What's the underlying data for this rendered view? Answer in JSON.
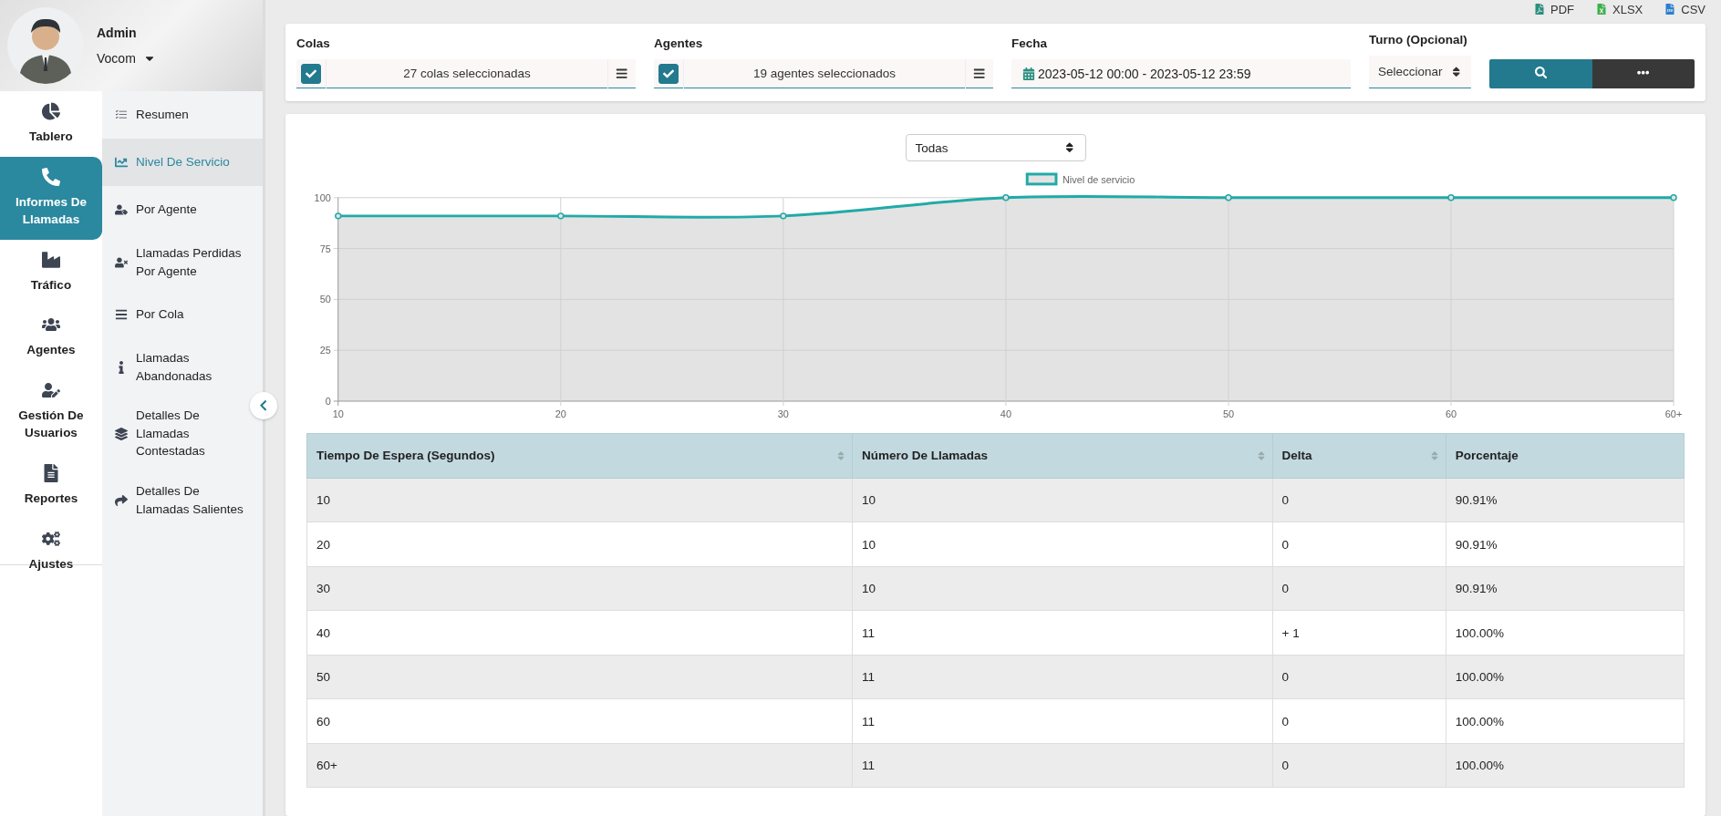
{
  "user": {
    "name": "Admin",
    "company": "Vocom"
  },
  "nav": [
    {
      "label": "Tablero",
      "selected": false
    },
    {
      "label": "Informes De Llamadas",
      "selected": true
    },
    {
      "label": "Tráfico",
      "selected": false
    },
    {
      "label": "Agentes",
      "selected": false
    },
    {
      "label": "Gestión De Usuarios",
      "selected": false
    },
    {
      "label": "Reportes",
      "selected": false
    },
    {
      "label": "Ajustes",
      "selected": false
    }
  ],
  "submenu": [
    {
      "label": "Resumen",
      "selected": false
    },
    {
      "label": "Nivel De Servicio",
      "selected": true
    },
    {
      "label": "Por Agente",
      "selected": false
    },
    {
      "label": "Llamadas Perdidas Por Agente",
      "selected": false
    },
    {
      "label": "Por Cola",
      "selected": false
    },
    {
      "label": "Llamadas Abandonadas",
      "selected": false
    },
    {
      "label": "Detalles De Llamadas Contestadas",
      "selected": false
    },
    {
      "label": "Detalles De Llamadas Salientes",
      "selected": false
    }
  ],
  "exports": [
    "PDF",
    "XLSX",
    "CSV"
  ],
  "filters": {
    "colas": {
      "label": "Colas",
      "checked": true,
      "value": "27 colas seleccionadas"
    },
    "agentes": {
      "label": "Agentes",
      "checked": true,
      "value": "19 agentes seleccionados"
    },
    "fecha": {
      "label": "Fecha",
      "value": "2023-05-12 00:00 - 2023-05-12 23:59"
    },
    "turno": {
      "label": "Turno (Opcional)",
      "value": "Seleccionar"
    }
  },
  "chart": {
    "select": "Todas",
    "chart_data": {
      "type": "line",
      "categories": [
        "10",
        "20",
        "30",
        "40",
        "50",
        "60",
        "60+"
      ],
      "series": [
        {
          "name": "Nivel de servicio",
          "color": "#20aaa8",
          "values": [
            91,
            91,
            91,
            100,
            100,
            100,
            100
          ],
          "marker": true
        }
      ],
      "ylim": [
        0,
        100
      ],
      "yticks": [
        0,
        25,
        50,
        75,
        100
      ],
      "grid": true
    }
  },
  "table": {
    "columns": [
      {
        "label": "Tiempo De Espera (Segundos)",
        "sortable": true
      },
      {
        "label": "Número De Llamadas",
        "sortable": true
      },
      {
        "label": "Delta",
        "sortable": true
      },
      {
        "label": "Porcentaje",
        "sortable": false
      }
    ],
    "rows": [
      [
        "10",
        "10",
        "0",
        "90.91%"
      ],
      [
        "20",
        "10",
        "0",
        "90.91%"
      ],
      [
        "30",
        "10",
        "0",
        "90.91%"
      ],
      [
        "40",
        "11",
        "+ 1",
        "100.00%"
      ],
      [
        "50",
        "11",
        "0",
        "100.00%"
      ],
      [
        "60",
        "11",
        "0",
        "100.00%"
      ],
      [
        "60+",
        "11",
        "0",
        "100.00%"
      ]
    ]
  }
}
